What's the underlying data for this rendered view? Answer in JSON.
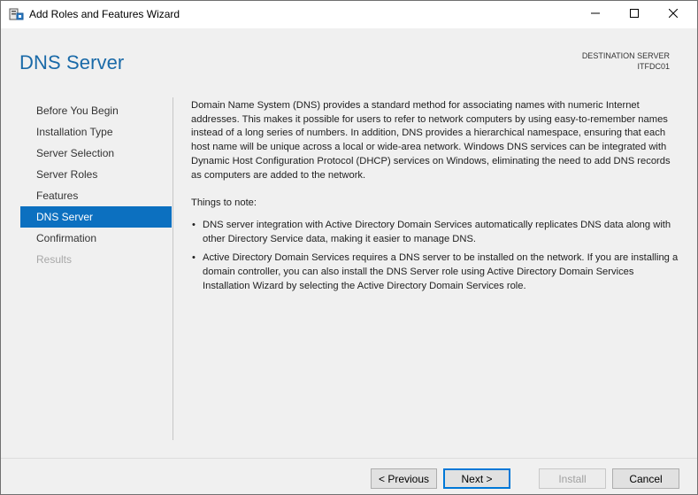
{
  "window": {
    "title": "Add Roles and Features Wizard"
  },
  "header": {
    "page_title": "DNS Server",
    "destination_label": "DESTINATION SERVER",
    "destination_server": "ITFDC01"
  },
  "nav": {
    "items": [
      {
        "label": "Before You Begin",
        "state": "normal"
      },
      {
        "label": "Installation Type",
        "state": "normal"
      },
      {
        "label": "Server Selection",
        "state": "normal"
      },
      {
        "label": "Server Roles",
        "state": "normal"
      },
      {
        "label": "Features",
        "state": "normal"
      },
      {
        "label": "DNS Server",
        "state": "active"
      },
      {
        "label": "Confirmation",
        "state": "normal"
      },
      {
        "label": "Results",
        "state": "disabled"
      }
    ]
  },
  "main": {
    "intro": "Domain Name System (DNS) provides a standard method for associating names with numeric Internet addresses. This makes it possible for users to refer to network computers by using easy-to-remember names instead of a long series of numbers. In addition, DNS provides a hierarchical namespace, ensuring that each host name will be unique across a local or wide-area network. Windows DNS services can be integrated with Dynamic Host Configuration Protocol (DHCP) services on Windows, eliminating the need to add DNS records as computers are added to the network.",
    "notes_title": "Things to note:",
    "bullets": [
      "DNS server integration with Active Directory Domain Services automatically replicates DNS data along with other Directory Service data, making it easier to manage DNS.",
      "Active Directory Domain Services requires a DNS server to be installed on the network. If you are installing a domain controller, you can also install the DNS Server role using Active Directory Domain Services Installation Wizard by selecting the Active Directory Domain Services role."
    ],
    "bullet_glyph": "•"
  },
  "footer": {
    "previous_label": "< Previous",
    "next_label": "Next >",
    "install_label": "Install",
    "cancel_label": "Cancel"
  },
  "colors": {
    "accent": "#0c70c0",
    "title_blue": "#1a6aa8",
    "panel_bg": "#f0f0f0"
  },
  "icons": {
    "app": "server-manager-icon",
    "minimize": "minimize-icon",
    "maximize": "maximize-icon",
    "close": "close-icon"
  }
}
